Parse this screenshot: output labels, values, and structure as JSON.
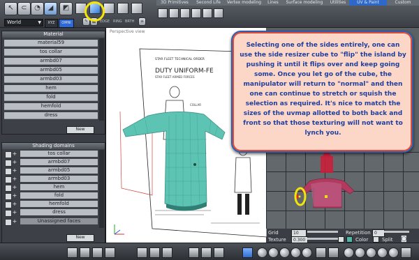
{
  "toolbar": {
    "world_label": "World",
    "xyz_label": "XYZ",
    "omni_label": "OMNI",
    "cube_labels": [
      "EDGE",
      "RING",
      "BRTH"
    ]
  },
  "tabs": [
    "3D Primitives",
    "Second Life",
    "Vertex modeling",
    "Lines",
    "Surface modeling",
    "Utilities",
    "UV & Paint",
    "Custom"
  ],
  "active_tab": "UV & Paint",
  "material_panel": {
    "title": "Material",
    "items": [
      "material59",
      "tos collar",
      "armbd07",
      "armbd05",
      "armbd03",
      "hem",
      "fold",
      "hemfold",
      "dress"
    ],
    "new_label": "New"
  },
  "shading_panel": {
    "title": "Shading domains",
    "items": [
      "tos collar",
      "armbd07",
      "armbd05",
      "armbd03",
      "hem",
      "fold",
      "hemfold",
      "dress",
      "Unassigned faces"
    ],
    "new_label": "New"
  },
  "viewport": {
    "label": "Perspective view",
    "doc_lines": [
      "STAR FLEET TECHNICAL ORDER",
      "DUTY UNIFORM-FE",
      "STAR FLEET ARMED FORCES",
      "COLLAR"
    ]
  },
  "callout": {
    "text": "Selecting one of the sides entirely, one can use the side resizer cube to \"flip\" the island by pushing it until it flips over and keep going some. Once you let go of the cube, the manipulator will return to \"normal\" and then one can continue to stretch or squish the selection as required. It's nice to match the sizes of the uvmap allotted to both back and front so that those texturing will not want to lynch you."
  },
  "uv_controls": {
    "grid_label": "Grid",
    "grid_value": "10",
    "texture_label": "Texture",
    "texture_value": "0.300",
    "repetition_label": "Repetition",
    "repetition_value": "0",
    "color_label": "Color",
    "split_label": "Split"
  },
  "colors": {
    "accent_tab": "#2e69c9",
    "callout_bg": "#fcd7c8",
    "callout_text": "#1e3e9e",
    "highlight_ring": "#f4e40a",
    "mesh": "#4fb6a8"
  }
}
